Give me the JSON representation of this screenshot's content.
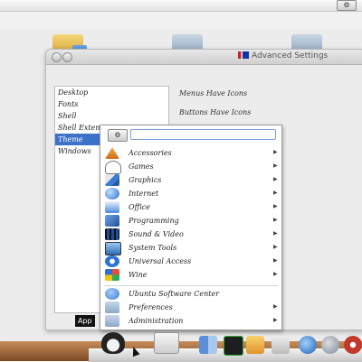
{
  "topbar": {
    "gear_icon": "gear-icon"
  },
  "window": {
    "title": "Advanced Settings",
    "sidebar": [
      "Desktop",
      "Fonts",
      "Shell",
      "Shell Extensions",
      "Theme",
      "Windows"
    ],
    "selected": "Theme",
    "settings": [
      "Menus Have Icons",
      "Buttons Have Icons"
    ]
  },
  "menu": {
    "search_value": "",
    "items": [
      {
        "label": "Accessories",
        "icon": "accessories-icon",
        "color": "#e0892a"
      },
      {
        "label": "Games",
        "icon": "games-icon",
        "color": "#333333"
      },
      {
        "label": "Graphics",
        "icon": "graphics-icon",
        "color": "#3a7bd5"
      },
      {
        "label": "Internet",
        "icon": "internet-icon",
        "color": "#2f6fd0"
      },
      {
        "label": "Office",
        "icon": "office-icon",
        "color": "#4a8be0"
      },
      {
        "label": "Programming",
        "icon": "programming-icon",
        "color": "#2b64b8"
      },
      {
        "label": "Sound & Video",
        "icon": "sound-video-icon",
        "color": "#1d4f9a"
      },
      {
        "label": "System Tools",
        "icon": "system-tools-icon",
        "color": "#2a6cb2"
      },
      {
        "label": "Universal Access",
        "icon": "universal-access-icon",
        "color": "#2f73d1"
      },
      {
        "label": "Wine",
        "icon": "wine-icon",
        "color": "#c0392b"
      },
      {
        "label": "Ubuntu Software Center",
        "icon": "software-center-icon",
        "color": "#3b7ed8"
      },
      {
        "label": "Preferences",
        "icon": "preferences-icon",
        "color": "#8aa8c8"
      },
      {
        "label": "Administration",
        "icon": "administration-icon",
        "color": "#8aa8c8"
      }
    ]
  },
  "tooltip": "App",
  "dock": {
    "icons": [
      "penguin-icon",
      "home-icon",
      "finder-icon",
      "terminal-icon",
      "notes-icon",
      "image-icon",
      "browser-icon",
      "globe-icon",
      "music-icon"
    ]
  }
}
